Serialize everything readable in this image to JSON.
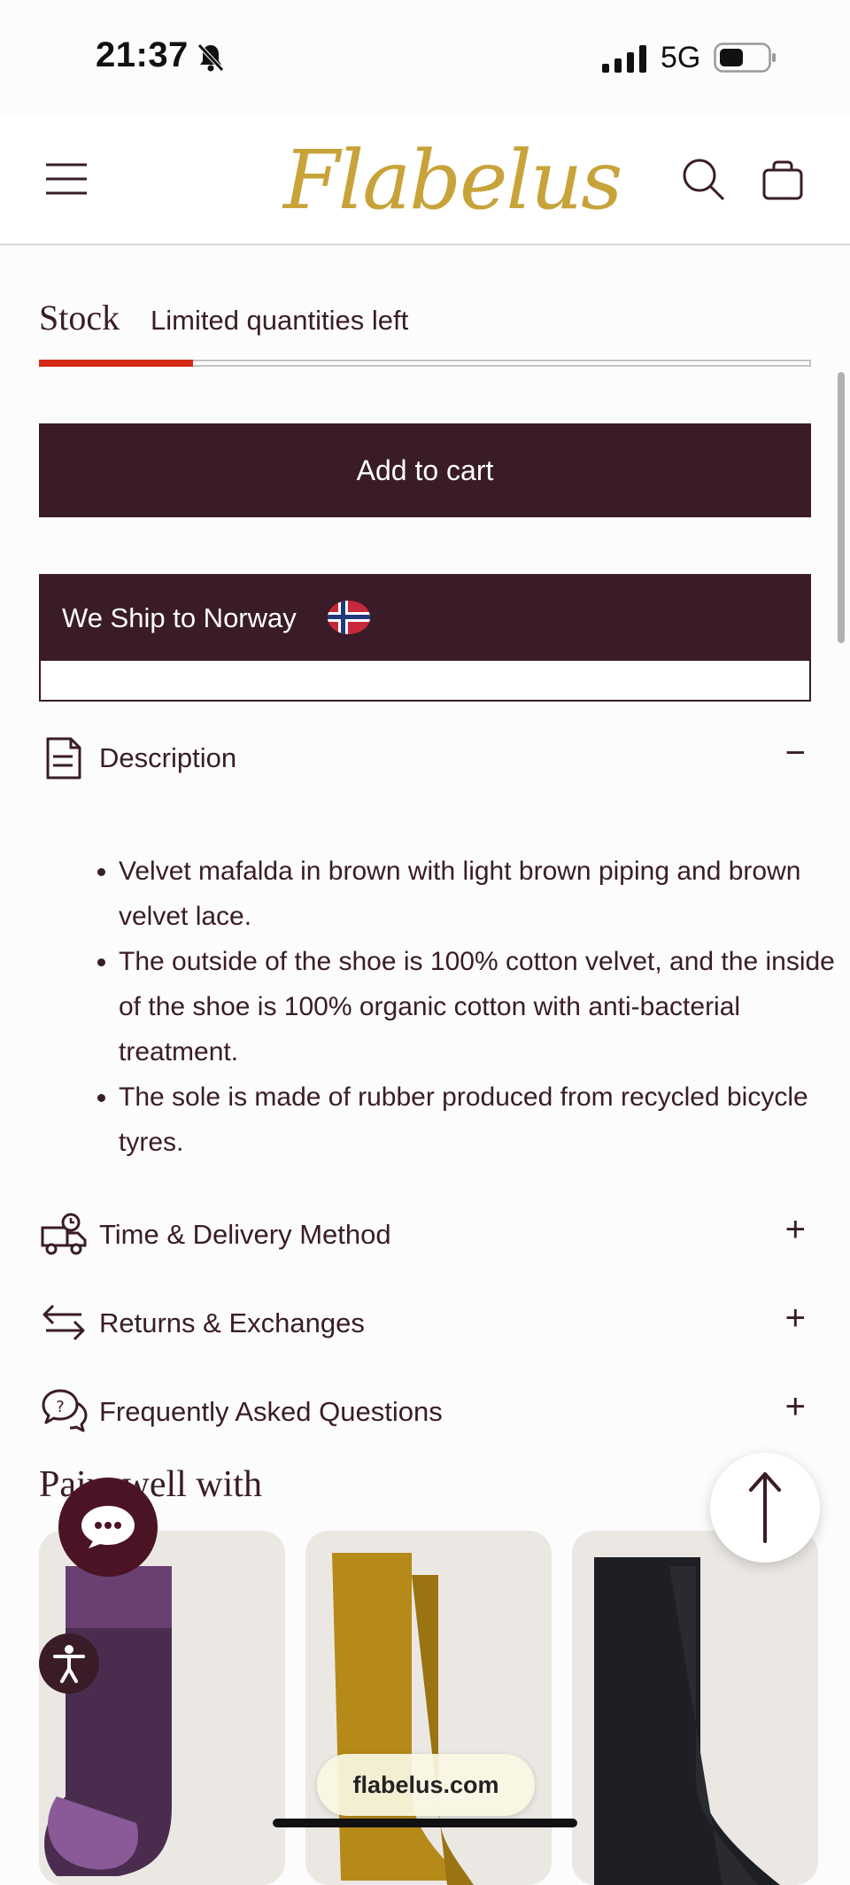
{
  "status_bar": {
    "time": "21:37",
    "network": "5G",
    "icons": [
      "bell-slash-icon",
      "signal-icon",
      "battery-icon"
    ]
  },
  "header": {
    "logo_text": "Flabelus",
    "icons": [
      "menu-icon",
      "search-icon",
      "bag-icon"
    ],
    "brand_color": "#c8a33a"
  },
  "stock": {
    "label": "Stock",
    "status_text": "Limited quantities left",
    "level_fraction": 0.2,
    "level_color": "#d42a16"
  },
  "cart": {
    "label": "Add to cart"
  },
  "shipping": {
    "label": "We Ship to Norway",
    "flag_icon": "norway-flag-icon"
  },
  "accordion": {
    "description": {
      "title": "Description",
      "toggle": "−",
      "bullets": [
        "Velvet mafalda in brown with light brown piping and brown velvet lace.",
        "The outside of the shoe is 100% cotton velvet, and the inside of the shoe is 100% organic cotton with anti-bacterial treatment.",
        "The sole is made of rubber produced from recycled bicycle tyres."
      ]
    },
    "delivery": {
      "title": "Time & Delivery Method",
      "toggle": "+"
    },
    "returns": {
      "title": "Returns & Exchanges",
      "toggle": "+"
    },
    "faq": {
      "title": "Frequently Asked Questions",
      "toggle": "+"
    }
  },
  "pairs": {
    "title": "Pairs well with",
    "products": [
      {
        "name": "purple-socks",
        "color": "#4a2d4e"
      },
      {
        "name": "mustard-socks",
        "color": "#b58a18"
      },
      {
        "name": "black-socks",
        "color": "#1e1f24"
      }
    ]
  },
  "browser": {
    "url": "flabelus.com"
  },
  "theme": {
    "primary": "#3a1c28",
    "accent": "#d42a16"
  }
}
